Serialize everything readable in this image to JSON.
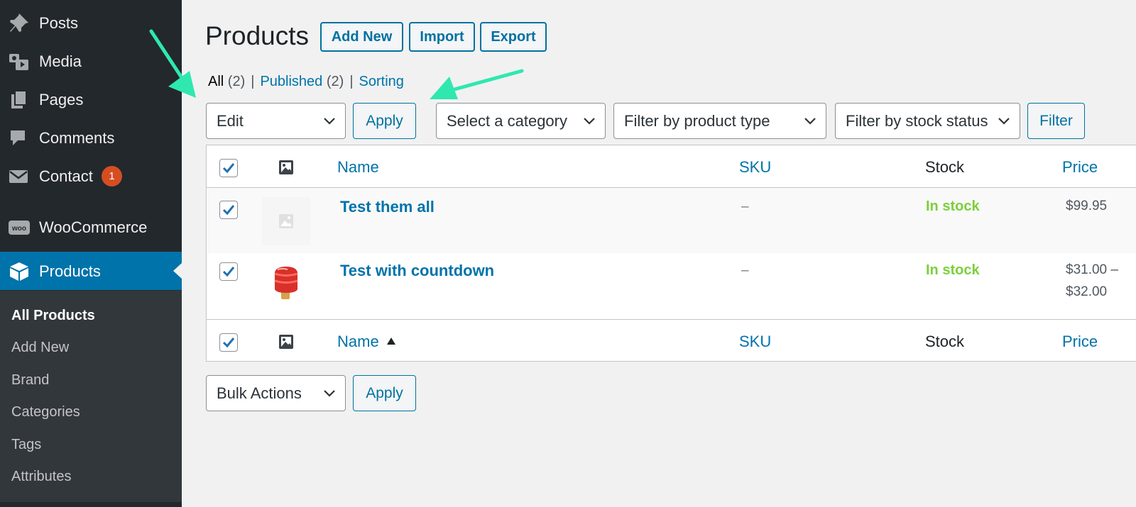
{
  "sidebar": {
    "items": [
      {
        "label": "Posts",
        "icon": "pin-icon"
      },
      {
        "label": "Media",
        "icon": "media-icon"
      },
      {
        "label": "Pages",
        "icon": "pages-icon"
      },
      {
        "label": "Comments",
        "icon": "comment-icon"
      },
      {
        "label": "Contact",
        "icon": "mail-icon",
        "badge": "1"
      },
      {
        "label": "WooCommerce",
        "icon": "woo-icon"
      },
      {
        "label": "Products",
        "icon": "box-icon",
        "current": true
      }
    ],
    "submenu": [
      "All Products",
      "Add New",
      "Brand",
      "Categories",
      "Tags",
      "Attributes"
    ]
  },
  "header": {
    "title": "Products",
    "buttons": [
      "Add New",
      "Import",
      "Export"
    ]
  },
  "views": {
    "all_label": "All",
    "all_count": "(2)",
    "published_label": "Published",
    "published_count": "(2)",
    "sorting_label": "Sorting",
    "separator": "|"
  },
  "tablenav_top": {
    "bulk_action_value": "Edit",
    "apply_label": "Apply",
    "category_filter": "Select a category",
    "type_filter": "Filter by product type",
    "stock_filter": "Filter by stock status",
    "filter_label": "Filter"
  },
  "table": {
    "columns": {
      "name": "Name",
      "sku": "SKU",
      "stock": "Stock",
      "price": "Price"
    },
    "rows": [
      {
        "name": "Test them all",
        "sku": "–",
        "stock": "In stock",
        "price_line1": "$99.95",
        "price_line2": ""
      },
      {
        "name": "Test with countdown",
        "sku": "–",
        "stock": "In stock",
        "price_line1": "$31.00 –",
        "price_line2": "$32.00"
      }
    ]
  },
  "tablenav_bottom": {
    "bulk_action_value": "Bulk Actions",
    "apply_label": "Apply"
  },
  "colors": {
    "sidebar_bg": "#23282d",
    "accent": "#0073aa",
    "in_stock": "#7ad03a",
    "badge": "#d54e21",
    "annotation_arrow": "#2ee8b0"
  }
}
